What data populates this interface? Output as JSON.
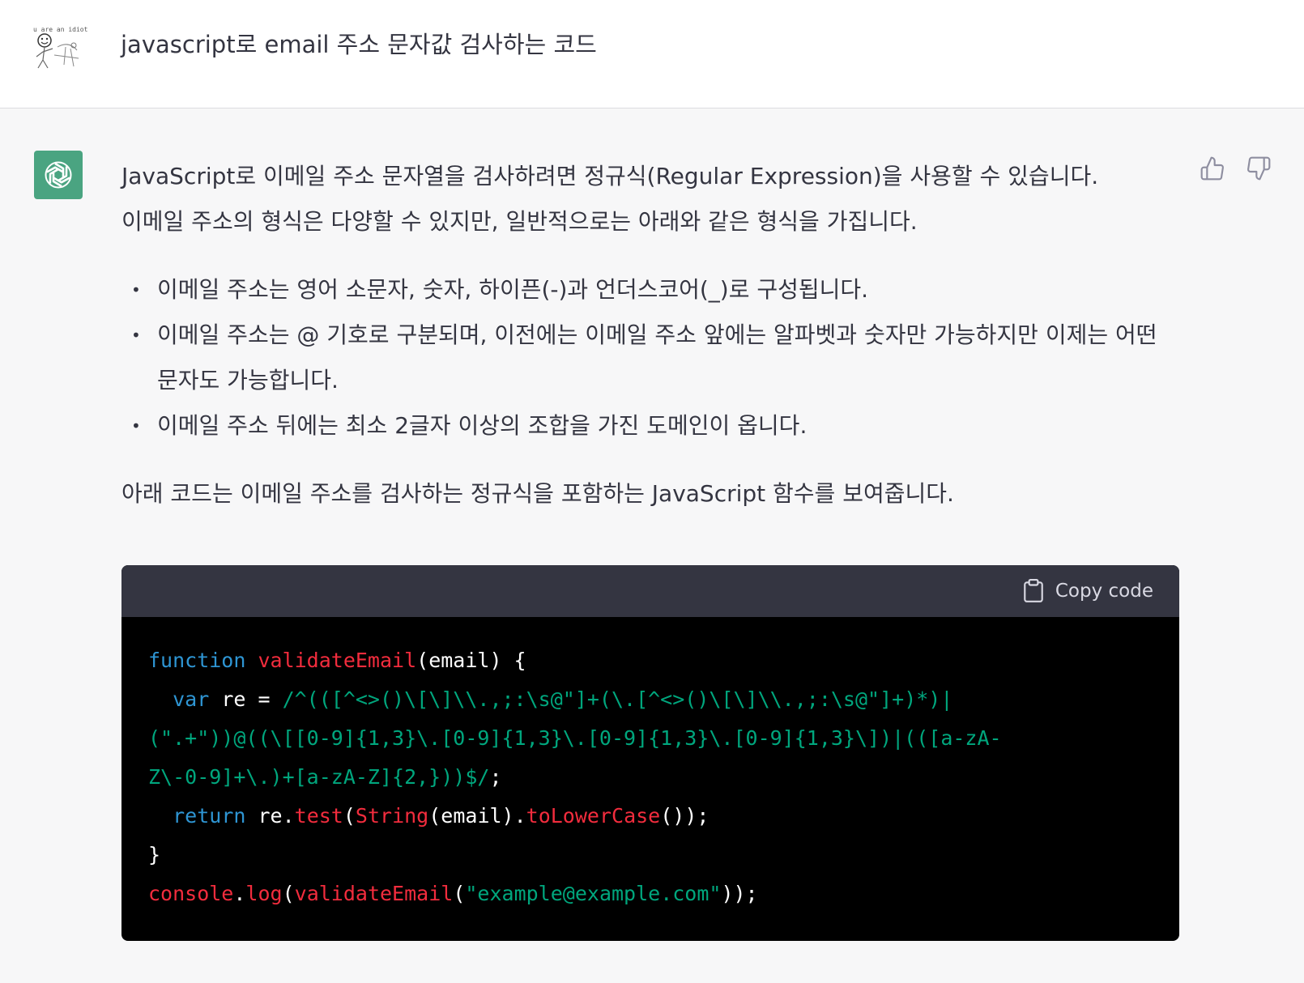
{
  "user": {
    "avatar_caption": "u are an idiot",
    "message": "javascript로 email 주소 문자값 검사하는 코드"
  },
  "assistant": {
    "avatar_icon": "openai-logo-icon",
    "intro_line1": "JavaScript로 이메일 주소 문자열을 검사하려면 정규식(Regular Expression)을 사용할 수 있습니다.",
    "intro_line2": "이메일 주소의 형식은 다양할 수 있지만, 일반적으로는 아래와 같은 형식을 가집니다.",
    "bullets": [
      "이메일 주소는 영어 소문자, 숫자, 하이픈(-)과 언더스코어(_)로 구성됩니다.",
      "이메일 주소는 @ 기호로 구분되며, 이전에는 이메일 주소 앞에는 알파벳과 숫자만 가능하지만 이제는 어떤 문자도 가능합니다.",
      "이메일 주소 뒤에는 최소 2글자 이상의 조합을 가진 도메인이 옵니다."
    ],
    "outro": "아래 코드는 이메일 주소를 검사하는 정규식을 포함하는 JavaScript 함수를 보여줍니다."
  },
  "feedback": {
    "thumbs_up_icon": "thumbs-up-icon",
    "thumbs_down_icon": "thumbs-down-icon"
  },
  "code_block": {
    "copy_label": "Copy code",
    "copy_icon": "clipboard-icon",
    "colors": {
      "keyword": "#2e95d3",
      "function": "#f22c3d",
      "string": "#00a67d",
      "plain": "#ffffff",
      "background": "#000000",
      "header": "#343541"
    },
    "tokens": {
      "l1_kw": "function",
      "l1_fn": " validateEmail",
      "l1_rest": "(email) {",
      "l2_indent": "  ",
      "l2_kw": "var",
      "l2_rest": " re = ",
      "l2_regex": "/^(([^<>()\\[\\]\\\\.,;:\\s@\"]+(\\.[^<>()\\[\\]\\\\.,;:\\s@\"]+)*)|",
      "l3_regex": "(\".+\"))@((\\[[0-9]{1,3}\\.[0-9]{1,3}\\.[0-9]{1,3}\\.[0-9]{1,3}\\])|(([a-zA-",
      "l4_regex": "Z\\-0-9]+\\.)+[a-zA-Z]{2,}))$/",
      "l4_rest": ";",
      "l5_indent": "  ",
      "l5_kw": "return",
      "l5_a": " re.",
      "l5_test": "test",
      "l5_b": "(",
      "l5_string": "String",
      "l5_c": "(email).",
      "l5_lower": "toLowerCase",
      "l5_d": "());",
      "l6": "}",
      "l7_console": "console",
      "l7_a": ".",
      "l7_log": "log",
      "l7_b": "(",
      "l7_fn": "validateEmail",
      "l7_c": "(",
      "l7_str": "\"example@example.com\"",
      "l7_d": "));"
    }
  }
}
